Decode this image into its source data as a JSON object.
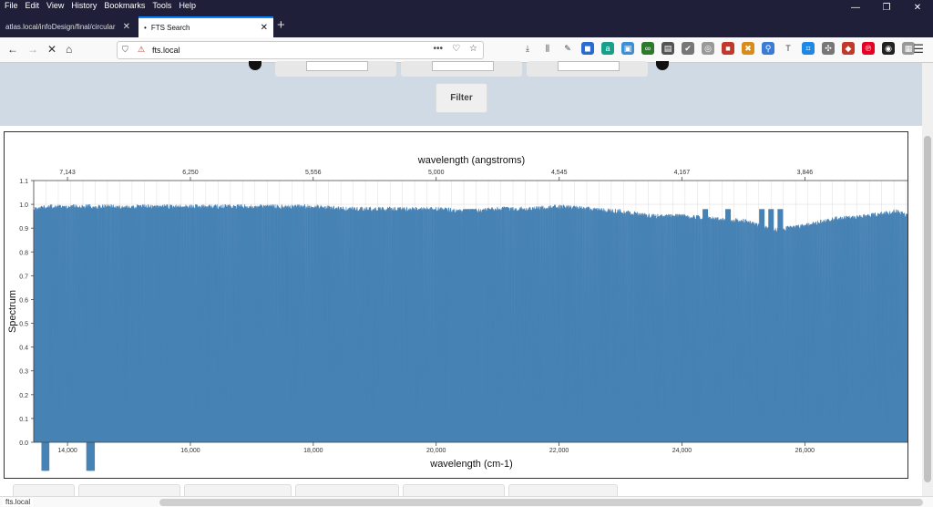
{
  "menubar": {
    "items": [
      "File",
      "Edit",
      "View",
      "History",
      "Bookmarks",
      "Tools",
      "Help"
    ]
  },
  "window_controls": {
    "minimize": "—",
    "restore": "❐",
    "close": "✕"
  },
  "tabs": [
    {
      "title": "atlas.local/infoDesign/final/circular",
      "active": false
    },
    {
      "title": "FTS Search",
      "active": true
    }
  ],
  "new_tab_symbol": "+",
  "nav": {
    "back": "←",
    "forward": "→",
    "stop": "✕",
    "home": "⌂",
    "url": "fts.local",
    "page_actions": "•••"
  },
  "extension_icons": [
    "download-icon",
    "library-icon",
    "eyedropper-icon",
    "badge-icon",
    "amazon-icon",
    "extension-icon",
    "glasses-icon",
    "reader-icon",
    "check-icon",
    "globe-icon",
    "lastpass-icon",
    "tools-icon",
    "key-icon",
    "text-icon",
    "screenshot-icon",
    "puzzle-icon",
    "dice-icon",
    "pinterest-icon",
    "hat-icon",
    "image-icon"
  ],
  "filter": {
    "button_label": "Filter",
    "fields": [
      "",
      "",
      ""
    ]
  },
  "chart_data": {
    "type": "area",
    "top_axis": {
      "label": "wavelength (angstroms)",
      "ticks": [
        "7,143",
        "6,250",
        "5,556",
        "5,000",
        "4,545",
        "4,167",
        "3,846"
      ]
    },
    "xlabel": "wavelength (cm-1)",
    "ylabel": "Spectrum",
    "xlim": [
      13450,
      27700
    ],
    "ylim": [
      0.0,
      1.1
    ],
    "xticks": [
      14000,
      16000,
      18000,
      20000,
      22000,
      24000,
      26000
    ],
    "xtick_labels": [
      "14,000",
      "16,000",
      "18,000",
      "20,000",
      "22,000",
      "24,000",
      "26,000"
    ],
    "yticks": [
      0.0,
      0.1,
      0.2,
      0.3,
      0.4,
      0.5,
      0.6,
      0.7,
      0.8,
      0.9,
      1.0,
      1.1
    ],
    "ytick_labels": [
      "0.0",
      "0.1",
      "0.2",
      "0.3",
      "0.4",
      "0.5",
      "0.6",
      "0.7",
      "0.8",
      "0.9",
      "1.0",
      "1.1"
    ],
    "grid": true,
    "color": "#4682b4",
    "envelope": {
      "x": [
        13450,
        13700,
        14000,
        14500,
        15000,
        15500,
        16000,
        16500,
        17000,
        17500,
        18000,
        18500,
        19000,
        19500,
        20000,
        20500,
        21000,
        21500,
        22000,
        22500,
        23000,
        23500,
        24000,
        24500,
        25000,
        25500,
        26000,
        26500,
        27000,
        27500,
        27700
      ],
      "y": [
        0.99,
        1.0,
        1.0,
        1.0,
        1.0,
        1.0,
        1.0,
        1.0,
        1.0,
        1.0,
        1.0,
        0.99,
        0.99,
        0.99,
        0.99,
        0.98,
        0.99,
        0.99,
        1.0,
        0.99,
        0.98,
        0.96,
        0.96,
        0.95,
        0.94,
        0.9,
        0.92,
        0.95,
        0.96,
        0.98,
        0.96
      ]
    },
    "absorption_lines": [
      {
        "x": 13620,
        "depth": -0.12
      },
      {
        "x": 13660,
        "depth": -0.12
      },
      {
        "x": 14350,
        "depth": -0.12
      },
      {
        "x": 14400,
        "depth": -0.12
      },
      {
        "x": 15350,
        "depth": 0.16
      },
      {
        "x": 16950,
        "depth": 0.06
      },
      {
        "x": 20500,
        "depth": 0.32
      },
      {
        "x": 20600,
        "depth": 0.28
      },
      {
        "x": 24380,
        "depth": 0.2
      },
      {
        "x": 24750,
        "depth": 0.16
      },
      {
        "x": 25300,
        "depth": 0.18
      },
      {
        "x": 25450,
        "depth": 0.14
      },
      {
        "x": 25600,
        "depth": 0.12
      }
    ]
  },
  "statusbar": {
    "text": "fts.local"
  }
}
